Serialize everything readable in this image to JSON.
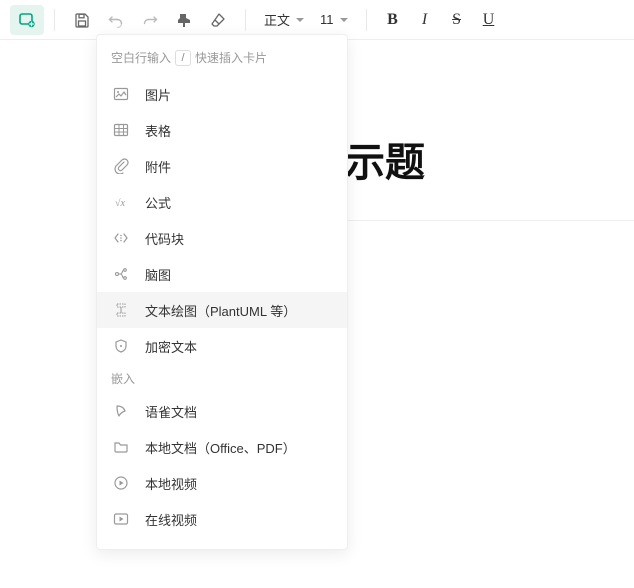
{
  "toolbar": {
    "text_style_label": "正文",
    "font_size": "11"
  },
  "dropdown": {
    "hint_prefix": "空白行输入",
    "hint_key": "/",
    "hint_suffix": "快速插入卡片",
    "items": [
      {
        "label": "图片"
      },
      {
        "label": "表格"
      },
      {
        "label": "附件"
      },
      {
        "label": "公式"
      },
      {
        "label": "代码块"
      },
      {
        "label": "脑图"
      },
      {
        "label": "文本绘图（PlantUML 等）"
      },
      {
        "label": "加密文本"
      }
    ],
    "section2_label": "嵌入",
    "items2": [
      {
        "label": "语雀文档"
      },
      {
        "label": "本地文档（Office、PDF）"
      },
      {
        "label": "本地视频"
      },
      {
        "label": "在线视频"
      }
    ]
  },
  "doc": {
    "title_fragment": "示题"
  }
}
